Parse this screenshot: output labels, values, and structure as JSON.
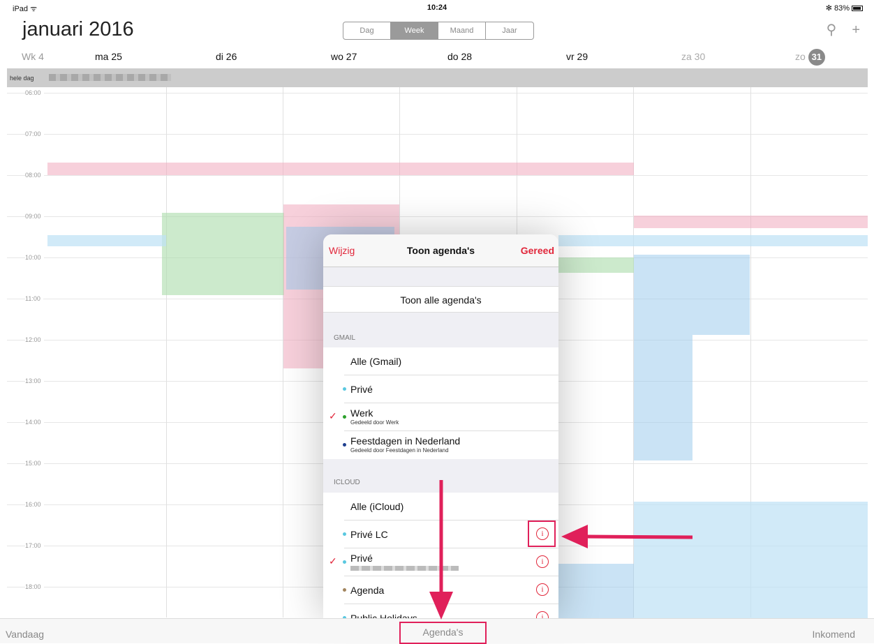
{
  "status": {
    "device": "iPad ᯤ",
    "time": "10:24",
    "battery": "✻ 83%"
  },
  "header": {
    "title": "januari 2016",
    "views": [
      "Dag",
      "Week",
      "Maand",
      "Jaar"
    ],
    "active_view": "Week",
    "search_icon": "search-icon",
    "add_icon": "plus-icon"
  },
  "days": {
    "week": "Wk 4",
    "labels": [
      "ma 25",
      "di 26",
      "wo 27",
      "do 28",
      "vr 29",
      "za 30",
      "zo"
    ],
    "today_num": "31"
  },
  "allday_label": "hele dag",
  "hours": [
    "06:00",
    "07:00",
    "08:00",
    "09:00",
    "10:00",
    "11:00",
    "12:00",
    "13:00",
    "14:00",
    "15:00",
    "16:00",
    "17:00",
    "18:00"
  ],
  "popover": {
    "edit": "Wijzig",
    "title": "Toon agenda's",
    "done": "Gereed",
    "show_all": "Toon alle agenda's",
    "gmail": {
      "header": "GMAIL",
      "all": "Alle (Gmail)",
      "items": [
        {
          "name": "Privé",
          "sub": "",
          "color": "#5ac8e0",
          "checked": false
        },
        {
          "name": "Werk",
          "sub": "Gedeeld door Werk",
          "color": "#2ca02c",
          "checked": true
        },
        {
          "name": "Feestdagen in Nederland",
          "sub": "Gedeeld door Feestdagen in Nederland",
          "color": "#1f3f8f",
          "checked": false
        }
      ]
    },
    "icloud": {
      "header": "ICLOUD",
      "all": "Alle (iCloud)",
      "items": [
        {
          "name": "Privé LC",
          "color": "#5ac8e0",
          "checked": false
        },
        {
          "name": "Privé",
          "color": "#5ac8e0",
          "checked": true
        },
        {
          "name": "Agenda",
          "color": "#a2845e",
          "checked": false
        },
        {
          "name": "Public Holidays",
          "color": "#5ac8e0",
          "checked": false
        }
      ]
    },
    "info_glyph": "i",
    "check_glyph": "✓"
  },
  "toolbar": {
    "today": "Vandaag",
    "calendars": "Agenda's",
    "inbox": "Inkomend"
  },
  "colors": {
    "accent": "#e1263a",
    "annotation": "#e0205a"
  }
}
